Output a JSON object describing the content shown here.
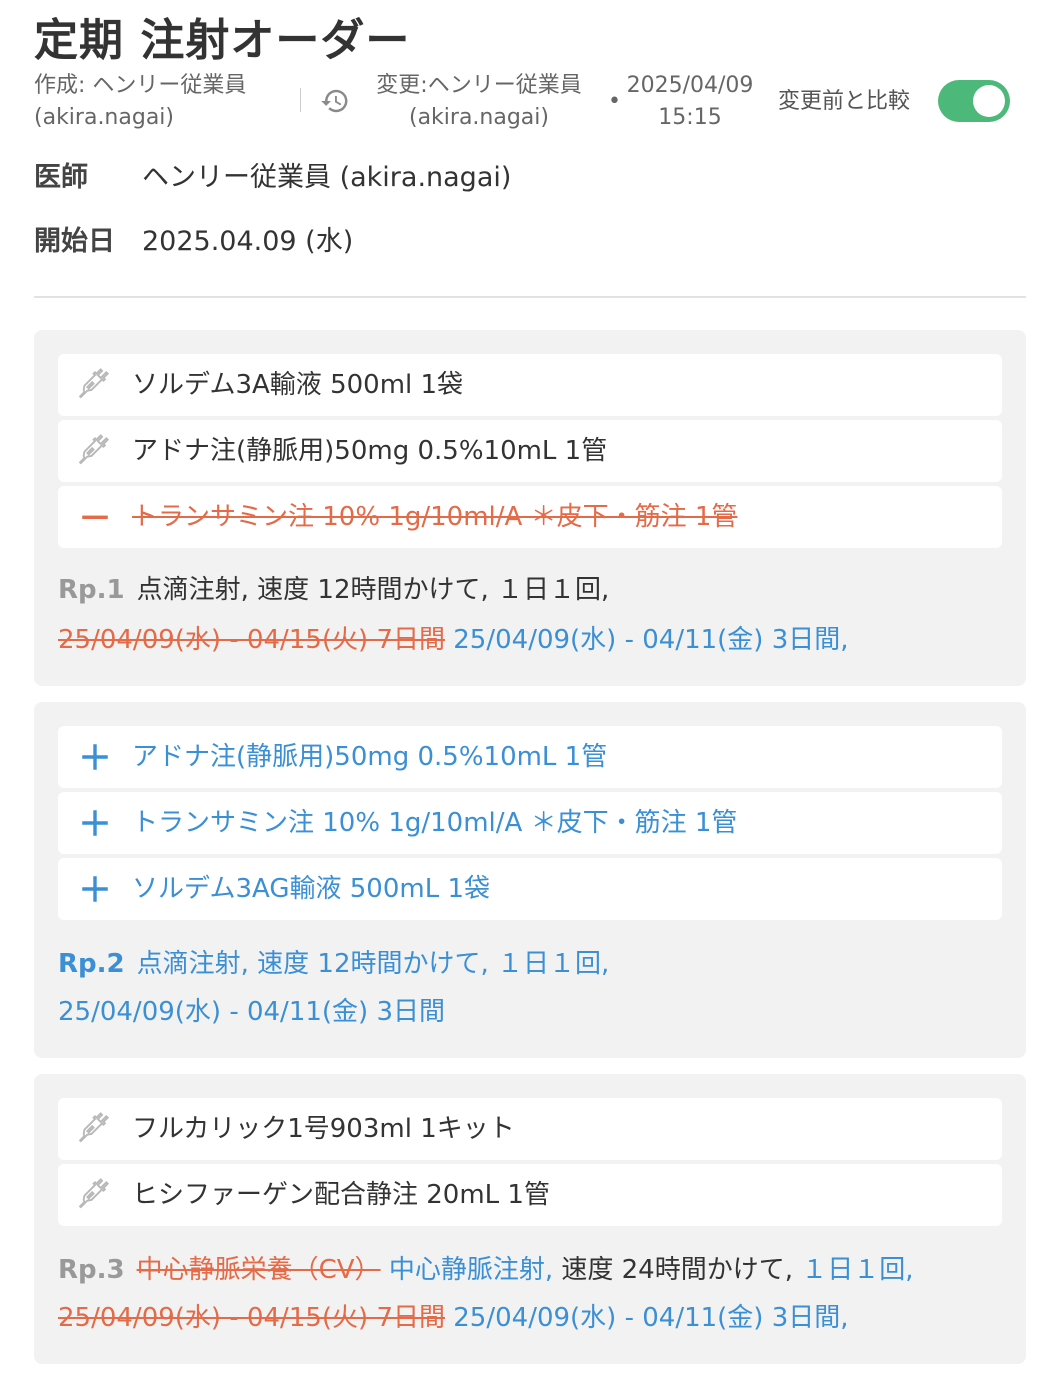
{
  "header": {
    "title": "定期 注射オーダー",
    "created_line1": "作成: ヘンリー従業員",
    "created_line2": "(akira.nagai)",
    "updated_line1": "変更:ヘンリー従業員",
    "updated_line2": "(akira.nagai)",
    "updated_date": "2025/04/09",
    "updated_time": "15:15",
    "compare_label": "変更前と比較",
    "compare_enabled": true,
    "toggle_color": "#4cb87a"
  },
  "fields": {
    "doctor_label": "医師",
    "doctor_value": "ヘンリー従業員 (akira.nagai)",
    "start_label": "開始日",
    "start_value": "2025.04.09 (水)"
  },
  "colors": {
    "added": "#3b8fd4",
    "removed": "#e46a48",
    "unchanged": "#333333",
    "card_bg": "#f2f2f2"
  },
  "rp1": {
    "drugs": [
      {
        "name": "ソルデム3A輸液 500ml  1袋",
        "status": "unchanged",
        "icon": "syringe-icon"
      },
      {
        "name": "アドナ注(静脈用)50mg 0.5%10mL  1管",
        "status": "unchanged",
        "icon": "syringe-icon"
      },
      {
        "name": "トランサミン注 10% 1g/10ml/A ＊皮下・筋注  1管",
        "status": "removed",
        "icon": "minus-icon"
      }
    ],
    "label": "Rp.1",
    "method": "点滴注射,  速度 12時間かけて,  １日１回,",
    "old_period": "25/04/09(水) - 04/15(火) 7日間",
    "new_period": "25/04/09(水) - 04/11(金) 3日間,"
  },
  "rp2": {
    "drugs": [
      {
        "name": "アドナ注(静脈用)50mg 0.5%10mL  1管",
        "status": "added",
        "icon": "plus-icon"
      },
      {
        "name": "トランサミン注 10% 1g/10ml/A ＊皮下・筋注  1管",
        "status": "added",
        "icon": "plus-icon"
      },
      {
        "name": "ソルデム3AG輸液 500mL  1袋",
        "status": "added",
        "icon": "plus-icon"
      }
    ],
    "label": "Rp.2",
    "method": "点滴注射,  速度 12時間かけて,  １日１回,",
    "period": "25/04/09(水) - 04/11(金) 3日間"
  },
  "rp3": {
    "drugs": [
      {
        "name": "フルカリック1号903ml  1キット",
        "status": "unchanged",
        "icon": "syringe-icon"
      },
      {
        "name": "ヒシファーゲン配合静注 20mL  1管",
        "status": "unchanged",
        "icon": "syringe-icon"
      }
    ],
    "label": "Rp.3",
    "old_method": "中心静脈栄養（CV）",
    "new_method": "中心静脈注射,",
    "speed": "速度 24時間かけて,",
    "frequency": "１日１回,",
    "old_period": "25/04/09(水) - 04/15(火) 7日間",
    "new_period": "25/04/09(水) - 04/11(金) 3日間,"
  }
}
